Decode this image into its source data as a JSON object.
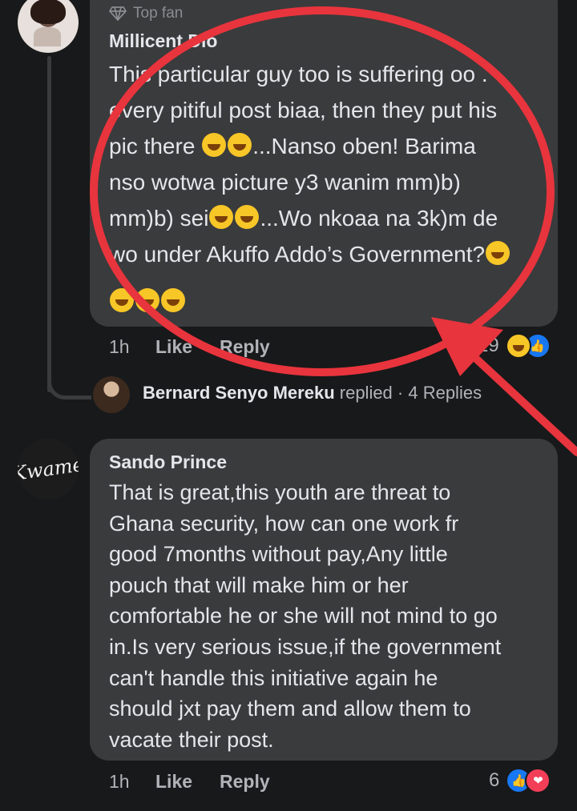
{
  "comment_1": {
    "badge": "Top fan",
    "author": "Millicent Dio",
    "lines": [
      "This particular guy too is suffering oo .",
      "every pitiful post biaa, then they put his",
      "pic there",
      "...Nanso oben! Barima",
      "nso wotwa picture y3 wanim mm)b)",
      "mm)b) sei",
      "...Wo nkoaa na 3k)m de",
      "wo under Akuffo Addo’s Government?"
    ],
    "time": "1h",
    "like_label": "Like",
    "reply_label": "Reply",
    "reaction_count": "29"
  },
  "reply_summary": {
    "name": "Bernard Senyo Mereku",
    "text": " replied · 4 Replies"
  },
  "comment_2": {
    "avatar_text": "Kwame",
    "author": "Sando Prince",
    "lines": [
      "That is great,this youth are threat to",
      "Ghana security, how can one work fr",
      "good 7months without pay,Any little",
      "pouch that will make him or her",
      "comfortable he or she will not mind to go",
      "in.Is very serious issue,if the government",
      "can't handle this initiative again he",
      "should jxt pay them and allow them to",
      "vacate their post."
    ],
    "time": "1h",
    "like_label": "Like",
    "reply_label": "Reply",
    "reaction_count": "6"
  },
  "icons": {
    "badge": "diamond-icon",
    "emoji": "rofl-emoji",
    "reactions_1": [
      "haha-icon",
      "like-icon"
    ],
    "reactions_2": [
      "like-icon",
      "love-icon"
    ]
  },
  "colors": {
    "background": "#18191a",
    "bubble": "#3a3b3c",
    "annotation": "#e8343d",
    "like": "#1877f2",
    "love": "#f33e58"
  }
}
